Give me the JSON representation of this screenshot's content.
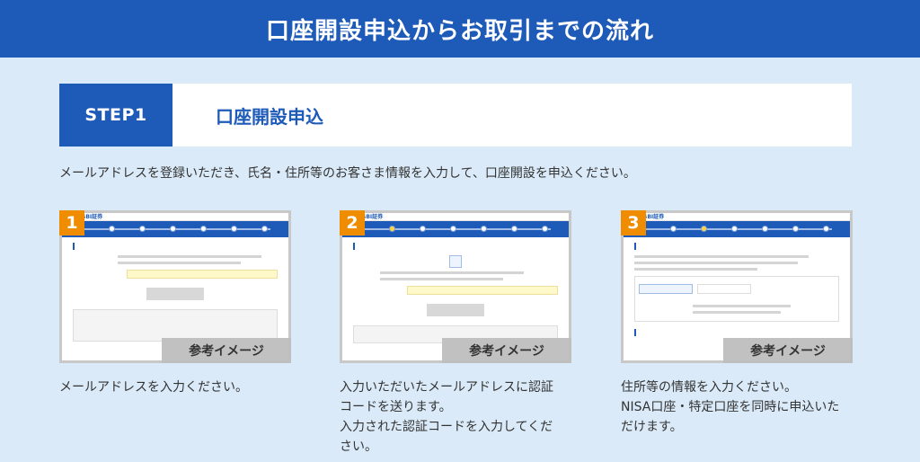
{
  "hero": {
    "title": "口座開設申込からお取引までの流れ"
  },
  "step": {
    "badge": "STEP1",
    "title": "口座開設申込",
    "description": "メールアドレスを登録いただき、氏名・住所等のお客さま情報を入力して、口座開設を申込ください。"
  },
  "cards": [
    {
      "number": "1",
      "reference_label": "参考イメージ",
      "caption_lines": [
        "メールアドレスを入力ください。"
      ]
    },
    {
      "number": "2",
      "reference_label": "参考イメージ",
      "caption_lines": [
        "入力いただいたメールアドレスに認証",
        "コードを送ります。",
        "入力された認証コードを入力してくだ",
        "さい。"
      ]
    },
    {
      "number": "3",
      "reference_label": "参考イメージ",
      "caption_lines": [
        "住所等の情報を入力ください。",
        "NISA口座・特定口座を同時に申込いた",
        "だけます。"
      ]
    }
  ],
  "colors": {
    "brand_blue": "#1e5bb8",
    "accent_orange": "#f08c00",
    "background": "#daeaf8"
  }
}
